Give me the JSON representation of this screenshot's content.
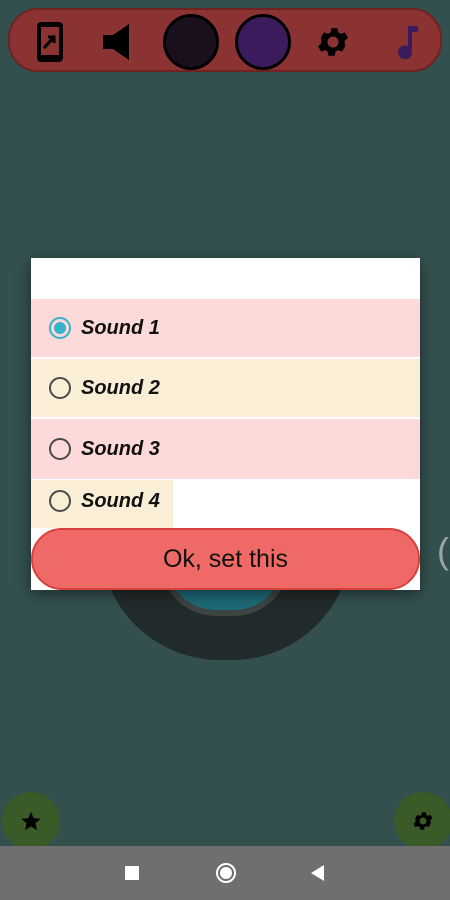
{
  "toolbar": {
    "icons": [
      "phone-share-icon",
      "speaker-icon",
      "color-swatch",
      "color-swatch",
      "gear-icon",
      "music-note-icon"
    ],
    "swatch_colors": [
      "#1a0f1c",
      "#3b1b5b"
    ],
    "music_color": "#3b1b5b"
  },
  "dialog": {
    "options": [
      {
        "label": "Sound 1",
        "selected": true,
        "bg": "#fdd9d9"
      },
      {
        "label": "Sound 2",
        "selected": false,
        "bg": "#faefd6"
      },
      {
        "label": "Sound 3",
        "selected": false,
        "bg": "#fdd9d9"
      },
      {
        "label": "Sound 4",
        "selected": false,
        "bg": "#faefd6"
      }
    ],
    "ok_label": "Ok, set this",
    "accent": "#33b5c9",
    "button_color": "#ef6a66"
  },
  "fab": {
    "left_icon": "star-icon",
    "right_icon": "gear-icon",
    "color": "#3a5a27"
  },
  "background": {
    "side_glyph": "("
  },
  "navbar": {
    "buttons": [
      "recents-icon",
      "home-icon",
      "back-icon"
    ]
  }
}
